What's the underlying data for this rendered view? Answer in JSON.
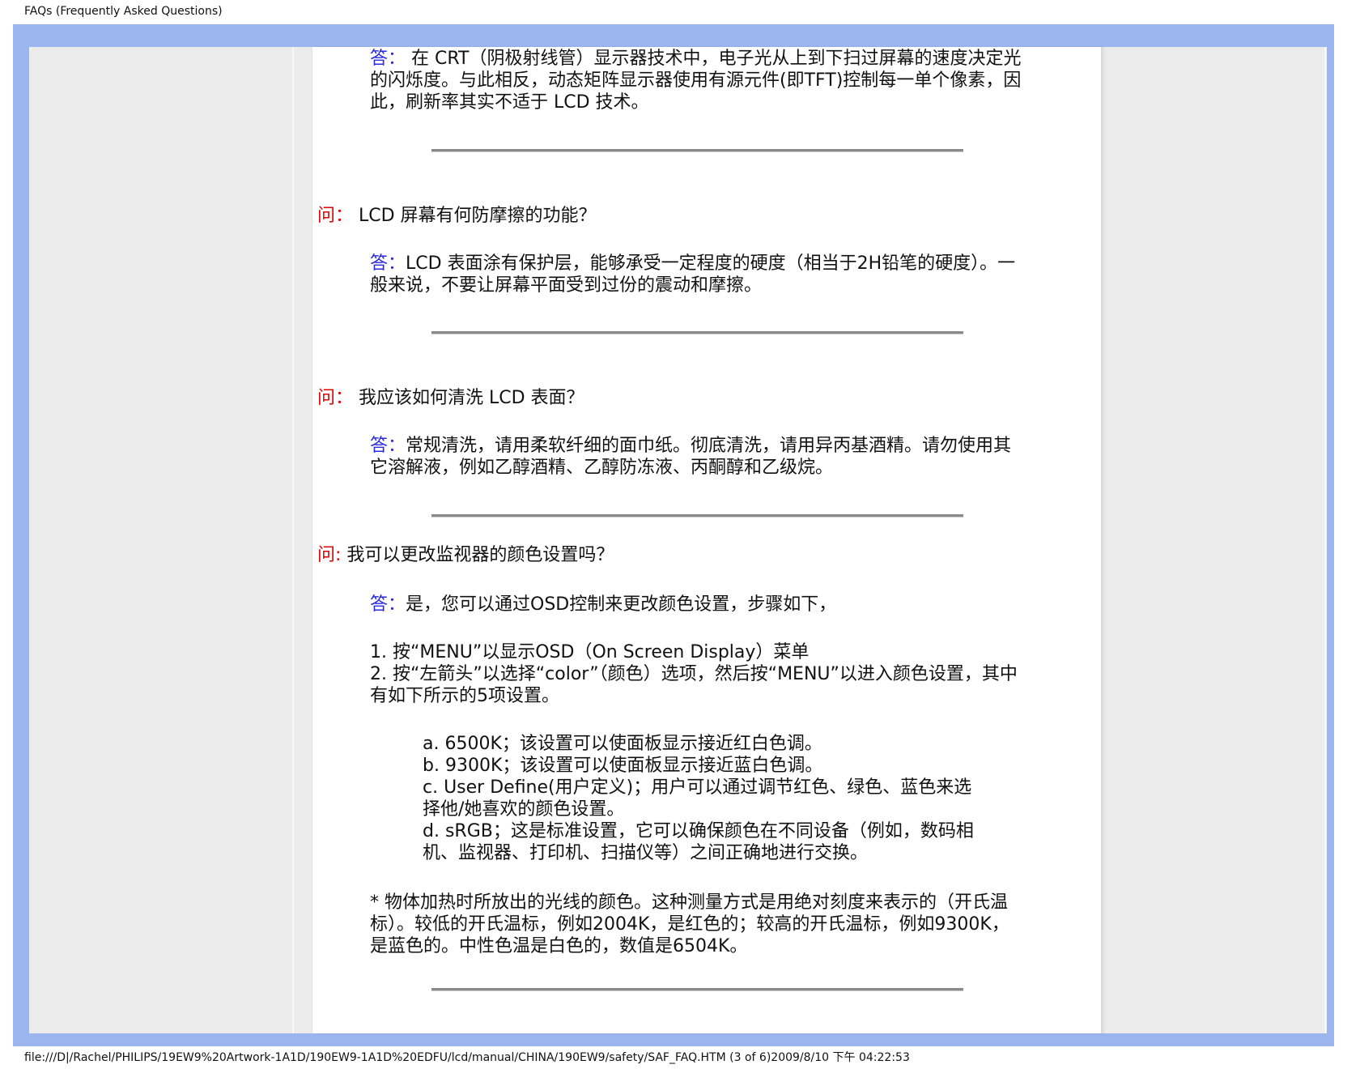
{
  "header_title": "FAQs (Frequently Asked Questions)",
  "footer_path": "file:///D|/Rachel/PHILIPS/19EW9%20Artwork-1A1D/190EW9-1A1D%20EDFU/lcd/manual/CHINA/190EW9/safety/SAF_FAQ.HTM (3 of 6)2009/8/10 下午 04:22:53",
  "labels": {
    "answer": "答：",
    "question": "问："
  },
  "items": [
    {
      "answer_text": " 在 CRT（阴极射线管）显示器技术中，电子光从上到下扫过屏幕的速度决定光的闪烁度。与此相反，动态矩阵显示器使用有源元件(即TFT)控制每一单个像素，因此，刷新率其实不适于 LCD 技术。"
    },
    {
      "question_label": "问：",
      "question_text": " LCD 屏幕有何防摩擦的功能？",
      "answer_text": "LCD 表面涂有保护层，能够承受一定程度的硬度（相当于2H铅笔的硬度）。一般来说，不要让屏幕平面受到过份的震动和摩擦。"
    },
    {
      "question_label": "问：",
      "question_text": " 我应该如何清洗 LCD 表面？",
      "answer_text": "常规清洗，请用柔软纤细的面巾纸。彻底清洗，请用异丙基酒精。请勿使用其它溶解液，例如乙醇酒精、乙醇防冻液、丙酮醇和乙级烷。"
    },
    {
      "question_label": "问:",
      "question_text": " 我可以更改监视器的颜色设置吗？",
      "answer_text": "是，您可以通过OSD控制来更改颜色设置，步骤如下，",
      "steps": [
        "1. 按“MENU”以显示OSD（On Screen Display）菜单",
        "2. 按“左箭头”以选择“color”（颜色）选项，然后按“MENU”以进入颜色设置，其中有如下所示的5项设置。"
      ],
      "options": [
        "a. 6500K；该设置可以使面板显示接近红白色调。",
        "b. 9300K；该设置可以使面板显示接近蓝白色调。",
        "c. User Define(用户定义)；用户可以通过调节红色、绿色、蓝色来选择他/她喜欢的颜色设置。",
        "d. sRGB；这是标准设置，它可以确保颜色在不同设备（例如，数码相机、监视器、打印机、扫描仪等）之间正确地进行交换。"
      ],
      "note": "* 物体加热时所放出的光线的颜色。这种测量方式是用绝对刻度来表示的（开氏温标）。较低的开氏温标，例如2004K，是红色的；较高的开氏温标，例如9300K，是蓝色的。中性色温是白色的，数值是6504K。"
    }
  ]
}
